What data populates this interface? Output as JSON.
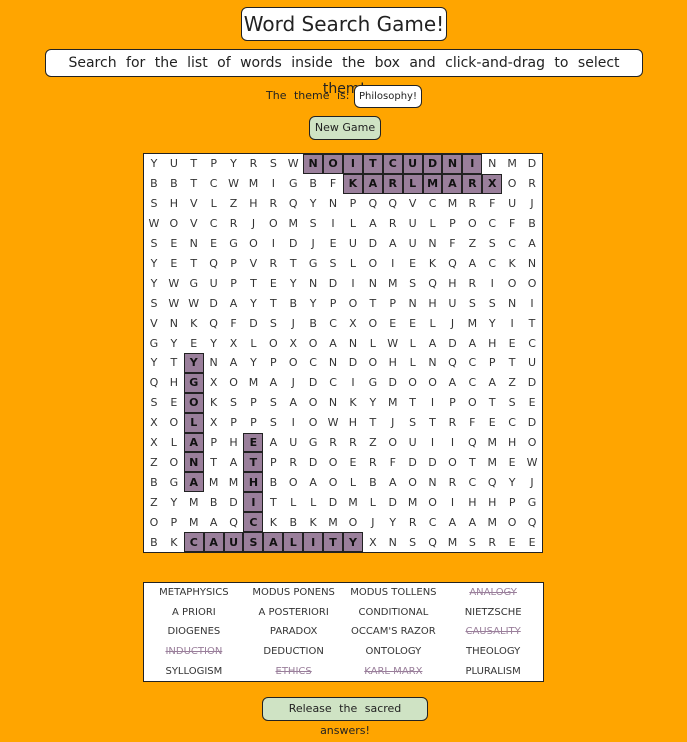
{
  "title": "Word Search Game!",
  "instructions": "Search for the list of words inside the box and click-and-drag to select them!",
  "theme_label": "The theme is:",
  "theme": "Philosophy!",
  "new_game_label": "New Game",
  "answers_label": "Release the sacred answers!",
  "highlight_color": "#9a7f9b",
  "grid": [
    "YUTPYRSWNOITCUDNINMD",
    "BBTCWMIGBFKARLMARXOR",
    "SHVLZHRQYNPQQVCMRFUJ",
    "WOVCRJOMSILARULPOCFB",
    "SENEGOIDJEUDAUNFZSCA",
    "YETQPVRTGSLOIEKQACKN",
    "YWGUPTEYNDINMSQHRIOO",
    "SWWDAYTBYPOTPNHUSSNI",
    "VNKQFDSJBCXOEELJMYIT",
    "GYEYXLOXOANLWLADAHEC",
    "YTYNAYPOCNDOHLNQCPTU",
    "QHGXOMAJDCIGDOOACAZD",
    "SEOKSPSAONKYMTIPOTSE",
    "XOLXPPSIOWHTJSTRFECD",
    "XLAPHEAUGRRZOUIIQMHO",
    "ZONTATPRDOERFDDOTMEW",
    "BGAMMHBOAOLBAONRCQYJ",
    "ZYMBDITLLDMLDMOIHHPG",
    "OPMAQCKBKMOJYRCAAMOQ",
    "BKCAUSALITYXNSQMSREE"
  ],
  "selected": [
    "0,8",
    "0,9",
    "0,10",
    "0,11",
    "0,12",
    "0,13",
    "0,14",
    "0,15",
    "0,16",
    "1,10",
    "1,11",
    "1,12",
    "1,13",
    "1,14",
    "1,15",
    "1,16",
    "1,17",
    "10,2",
    "11,2",
    "12,2",
    "13,2",
    "14,2",
    "15,2",
    "16,2",
    "14,5",
    "15,5",
    "16,5",
    "17,5",
    "18,5",
    "19,2",
    "19,3",
    "19,4",
    "19,5",
    "19,6",
    "19,7",
    "19,8",
    "19,9",
    "19,10"
  ],
  "words": [
    {
      "text": "METAPHYSICS",
      "found": false
    },
    {
      "text": "MODUS PONENS",
      "found": false
    },
    {
      "text": "MODUS TOLLENS",
      "found": false
    },
    {
      "text": "ANALOGY",
      "found": true
    },
    {
      "text": "A PRIORI",
      "found": false
    },
    {
      "text": "A POSTERIORI",
      "found": false
    },
    {
      "text": "CONDITIONAL",
      "found": false
    },
    {
      "text": "NIETZSCHE",
      "found": false
    },
    {
      "text": "DIOGENES",
      "found": false
    },
    {
      "text": "PARADOX",
      "found": false
    },
    {
      "text": "OCCAM'S RAZOR",
      "found": false
    },
    {
      "text": "CAUSALITY",
      "found": true
    },
    {
      "text": "INDUCTION",
      "found": true
    },
    {
      "text": "DEDUCTION",
      "found": false
    },
    {
      "text": "ONTOLOGY",
      "found": false
    },
    {
      "text": "THEOLOGY",
      "found": false
    },
    {
      "text": "SYLLOGISM",
      "found": false
    },
    {
      "text": "ETHICS",
      "found": true
    },
    {
      "text": "KARL MARX",
      "found": true
    },
    {
      "text": "PLURALISM",
      "found": false
    }
  ]
}
